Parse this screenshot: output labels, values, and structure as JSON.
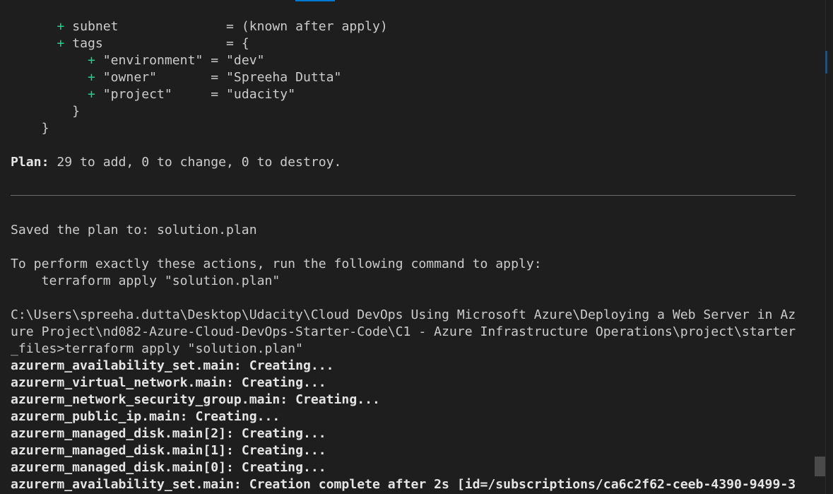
{
  "colors": {
    "background": "#1e1e1e",
    "text": "#cccccc",
    "plus": "#23d18b",
    "accent": "#0078d4"
  },
  "plan": {
    "subnet_plus": "+",
    "subnet_text": "subnet              = (known after apply)",
    "tags_plus": "+",
    "tags_text": "tags                = {",
    "environment_plus": "+",
    "environment_text": "\"environment\" = \"dev\"",
    "owner_plus": "+",
    "owner_text": "\"owner\"       = \"Spreeha Dutta\"",
    "project_plus": "+",
    "project_text": "\"project\"     = \"udacity\"",
    "close_inner": "}",
    "close_outer": "}",
    "summary_label": "Plan:",
    "summary_text": " 29 to add, 0 to change, 0 to destroy."
  },
  "saved": {
    "saved_line": "Saved the plan to: solution.plan",
    "perform_line": "To perform exactly these actions, run the following command to apply:",
    "command_line": "terraform apply \"solution.plan\""
  },
  "prompt": {
    "line1": "C:\\Users\\spreeha.dutta\\Desktop\\Udacity\\Cloud DevOps Using Microsoft Azure\\Deploying a Web Server in Az",
    "line2": "ure Project\\nd082-Azure-Cloud-DevOps-Starter-Code\\C1 - Azure Infrastructure Operations\\project\\starter",
    "line3": "_files>terraform apply \"solution.plan\""
  },
  "apply": [
    {
      "resource": "azurerm_availability_set.main:",
      "status": " Creating..."
    },
    {
      "resource": "azurerm_virtual_network.main:",
      "status": " Creating..."
    },
    {
      "resource": "azurerm_network_security_group.main:",
      "status": " Creating..."
    },
    {
      "resource": "azurerm_public_ip.main:",
      "status": " Creating..."
    },
    {
      "resource": "azurerm_managed_disk.main[2]:",
      "status": " Creating..."
    },
    {
      "resource": "azurerm_managed_disk.main[1]:",
      "status": " Creating..."
    },
    {
      "resource": "azurerm_managed_disk.main[0]:",
      "status": " Creating..."
    },
    {
      "resource": "azurerm_availability_set.main:",
      "status": " Creation complete after 2s [id=/subscriptions/ca6c2f62-ceeb-4390-9499-3"
    }
  ]
}
